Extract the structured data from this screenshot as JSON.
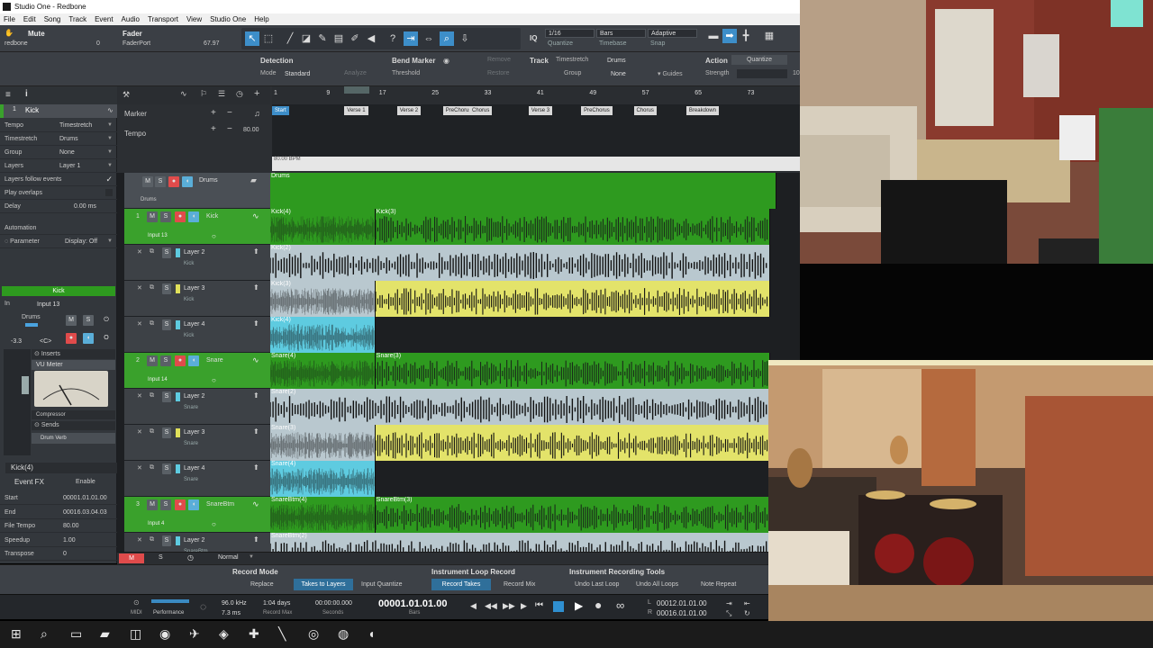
{
  "window": {
    "title": "Studio One - Redbone"
  },
  "menu": [
    "File",
    "Edit",
    "Song",
    "Track",
    "Event",
    "Audio",
    "Transport",
    "View",
    "Studio One",
    "Help"
  ],
  "toolbar": {
    "mute_label": "Mute",
    "mute_song": "redbone",
    "mute_value": "0",
    "fader_label": "Fader",
    "fader_device": "FaderPort",
    "fader_value": "67.97",
    "iq_label": "IQ",
    "quantize_value": "1/16",
    "quantize_label": "Quantize",
    "timebase_value": "Bars",
    "timebase_label": "Timebase",
    "snap_value": "Adaptive",
    "snap_label": "Snap"
  },
  "inspector_strip": {
    "detection_h": "Detection",
    "mode_label": "Mode",
    "mode_value": "Standard",
    "analyze": "Analyze",
    "bend_h": "Bend Marker",
    "threshold_label": "Threshold",
    "remove": "Remove",
    "restore": "Restore",
    "track_h": "Track",
    "timestretch_label": "Timestretch",
    "timestretch_value": "Drums",
    "group_label": "Group",
    "group_value": "None",
    "guides": "Guides",
    "action_h": "Action",
    "quantize_btn": "Quantize",
    "strength_label": "Strength",
    "strength_value": "10"
  },
  "track_inspector": {
    "track_num": "1",
    "track_name": "Kick",
    "rows": [
      {
        "label": "Tempo",
        "value": "Timestretch"
      },
      {
        "label": "Timestretch",
        "value": "Drums"
      },
      {
        "label": "Group",
        "value": "None"
      },
      {
        "label": "Layers",
        "value": "Layer 1"
      }
    ],
    "layers_follow": "Layers follow events",
    "play_overlaps": "Play overlaps",
    "delay_label": "Delay",
    "delay_value": "0.00 ms",
    "automation_label": "Automation",
    "parameter_label": "Parameter",
    "parameter_value": "Display: Off",
    "channel_name": "Kick",
    "in_label": "In",
    "in_value": "Input 13",
    "bus_name": "Drums",
    "fader_db": "-3.3",
    "pan": "<C>",
    "inserts": "Inserts",
    "vu": "VU Meter",
    "compressor": "Compressor",
    "sends": "Sends",
    "drum_verb": "Drum Verb"
  },
  "event_inspector": {
    "title": "Kick(4)",
    "event_fx": "Event FX",
    "enable": "Enable",
    "rows": [
      {
        "label": "Start",
        "value": "00001.01.01.00"
      },
      {
        "label": "End",
        "value": "00016.03.04.03"
      },
      {
        "label": "File Tempo",
        "value": "80.00"
      },
      {
        "label": "Speedup",
        "value": "1.00"
      },
      {
        "label": "Transpose",
        "value": "0"
      }
    ]
  },
  "global_tracks": {
    "marker": "Marker",
    "tempo": "Tempo",
    "tempo_value": "80.00",
    "bpm_readout": "80.00 BPM"
  },
  "ruler": {
    "bars": [
      "1",
      "9",
      "17",
      "25",
      "33",
      "41",
      "49",
      "57",
      "65",
      "73"
    ]
  },
  "markers": [
    {
      "name": "Start",
      "bar": 1
    },
    {
      "name": "Verse 1",
      "bar": 12
    },
    {
      "name": "Verse 2",
      "bar": 20
    },
    {
      "name": "PreChorus",
      "bar": 27
    },
    {
      "name": "Chorus",
      "bar": 31
    },
    {
      "name": "Verse 3",
      "bar": 40
    },
    {
      "name": "PreChorus",
      "bar": 48
    },
    {
      "name": "Chorus",
      "bar": 56
    },
    {
      "name": "Breakdown",
      "bar": 64
    }
  ],
  "tracks": [
    {
      "type": "folder",
      "name": "Drums",
      "sub": "Drums",
      "clips": [
        {
          "name": "Drums",
          "start": 1,
          "end": 78,
          "color": "#2e9a1f"
        }
      ]
    },
    {
      "type": "track",
      "num": "1",
      "name": "Kick",
      "input": "Input 13",
      "clips": [
        {
          "name": "Kick(4)",
          "start": 1,
          "end": 17,
          "color": "#2e9a1f"
        },
        {
          "name": "Kick(3)",
          "start": 17,
          "end": 77,
          "color": "#2e9a1f"
        }
      ]
    },
    {
      "type": "layer",
      "name": "Layer 2",
      "sub": "Kick",
      "swatch": "#5ecbe0",
      "clips": [
        {
          "name": "Kick(2)",
          "start": 1,
          "end": 77,
          "color": "#b9c8cf"
        }
      ]
    },
    {
      "type": "layer",
      "name": "Layer 3",
      "sub": "Kick",
      "swatch": "#e0e05a",
      "clips": [
        {
          "name": "Kick(3)",
          "start": 1,
          "end": 17,
          "color": "#b9c8cf"
        },
        {
          "name": "",
          "start": 17,
          "end": 77,
          "color": "#e3e36a"
        }
      ]
    },
    {
      "type": "layer",
      "name": "Layer 4",
      "sub": "Kick",
      "swatch": "#5ecbe0",
      "clips": [
        {
          "name": "Kick(4)",
          "start": 1,
          "end": 17,
          "color": "#5ecbe0"
        }
      ]
    },
    {
      "type": "track",
      "num": "2",
      "name": "Snare",
      "input": "Input 14",
      "clips": [
        {
          "name": "Snare(4)",
          "start": 1,
          "end": 17,
          "color": "#2e9a1f"
        },
        {
          "name": "Snare(3)",
          "start": 17,
          "end": 77,
          "color": "#2e9a1f"
        }
      ]
    },
    {
      "type": "layer",
      "name": "Layer 2",
      "sub": "Snare",
      "swatch": "#5ecbe0",
      "clips": [
        {
          "name": "Snare(2)",
          "start": 1,
          "end": 77,
          "color": "#b9c8cf"
        }
      ]
    },
    {
      "type": "layer",
      "name": "Layer 3",
      "sub": "Snare",
      "swatch": "#e0e05a",
      "clips": [
        {
          "name": "Snare(3)",
          "start": 1,
          "end": 17,
          "color": "#b9c8cf"
        },
        {
          "name": "",
          "start": 17,
          "end": 77,
          "color": "#e3e36a"
        }
      ]
    },
    {
      "type": "layer",
      "name": "Layer 4",
      "sub": "Snare",
      "swatch": "#5ecbe0",
      "clips": [
        {
          "name": "Snare(4)",
          "start": 1,
          "end": 17,
          "color": "#5ecbe0"
        }
      ]
    },
    {
      "type": "track",
      "num": "3",
      "name": "SnareBtm",
      "input": "Input 4",
      "clips": [
        {
          "name": "SnareBtm(4)",
          "start": 1,
          "end": 17,
          "color": "#2e9a1f"
        },
        {
          "name": "SnareBtm(3)",
          "start": 17,
          "end": 77,
          "color": "#2e9a1f"
        }
      ]
    },
    {
      "type": "layer",
      "name": "Layer 2",
      "sub": "SnareBtm",
      "swatch": "#5ecbe0",
      "clips": [
        {
          "name": "SnareBtm(2)",
          "start": 1,
          "end": 77,
          "color": "#b9c8cf"
        }
      ]
    }
  ],
  "lane_footer": {
    "m": "M",
    "s": "S",
    "mode": "Normal"
  },
  "record_panel": {
    "record_mode_h": "Record Mode",
    "replace": "Replace",
    "takes_to_layers": "Takes to Layers",
    "input_quantize": "Input Quantize",
    "loop_h": "Instrument Loop Record",
    "record_takes": "Record Takes",
    "record_mix": "Record Mix",
    "tools_h": "Instrument Recording Tools",
    "undo_last": "Undo Last Loop",
    "undo_all": "Undo All Loops",
    "note_repeat": "Note Repeat"
  },
  "transport": {
    "midi": "MIDI",
    "performance": "Performance",
    "sample_rate": "96.0 kHz",
    "latency": "7.3 ms",
    "record_max_value": "1:04 days",
    "record_max": "Record Max",
    "seconds_value": "00:00:00.000",
    "seconds": "Seconds",
    "bars_value": "00001.01.01.00",
    "bars": "Bars",
    "loop_l": "00012.01.01.00",
    "loop_r": "00016.01.01.00"
  },
  "taskbar_icons": [
    "windows-start",
    "search",
    "task-view",
    "file-explorer",
    "store",
    "chrome",
    "studio-one",
    "app1",
    "app2",
    "pen",
    "obs",
    "chrome2",
    "other"
  ]
}
